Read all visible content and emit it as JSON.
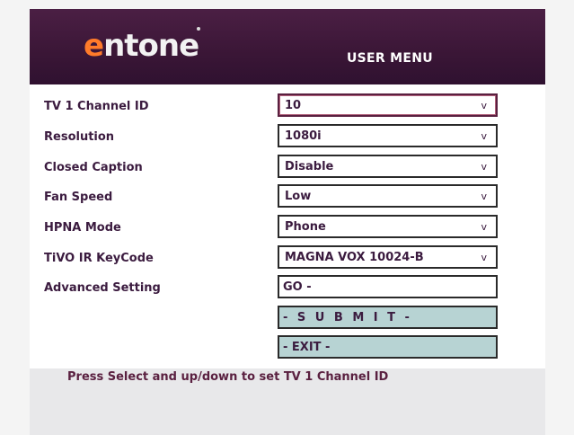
{
  "header": {
    "logo_e": "e",
    "logo_rest": "ntone",
    "title": "USER MENU"
  },
  "settings": [
    {
      "label": "TV 1 Channel ID",
      "value": "10",
      "arrow": "v"
    },
    {
      "label": "Resolution",
      "value": "1080i",
      "arrow": "v"
    },
    {
      "label": "Closed Caption",
      "value": "Disable",
      "arrow": "v"
    },
    {
      "label": "Fan Speed",
      "value": "Low",
      "arrow": "v"
    },
    {
      "label": "HPNA Mode",
      "value": "Phone",
      "arrow": "v"
    },
    {
      "label": "TiVO IR KeyCode",
      "value": "MAGNA VOX 10024-B",
      "arrow": "v"
    }
  ],
  "advanced": {
    "label": "Advanced Setting",
    "button": "GO -"
  },
  "actions": {
    "submit": "- S U B M I T -",
    "exit": "- EXIT -"
  },
  "footer": {
    "hint": "Press Select and up/down to set TV 1 Channel ID"
  }
}
